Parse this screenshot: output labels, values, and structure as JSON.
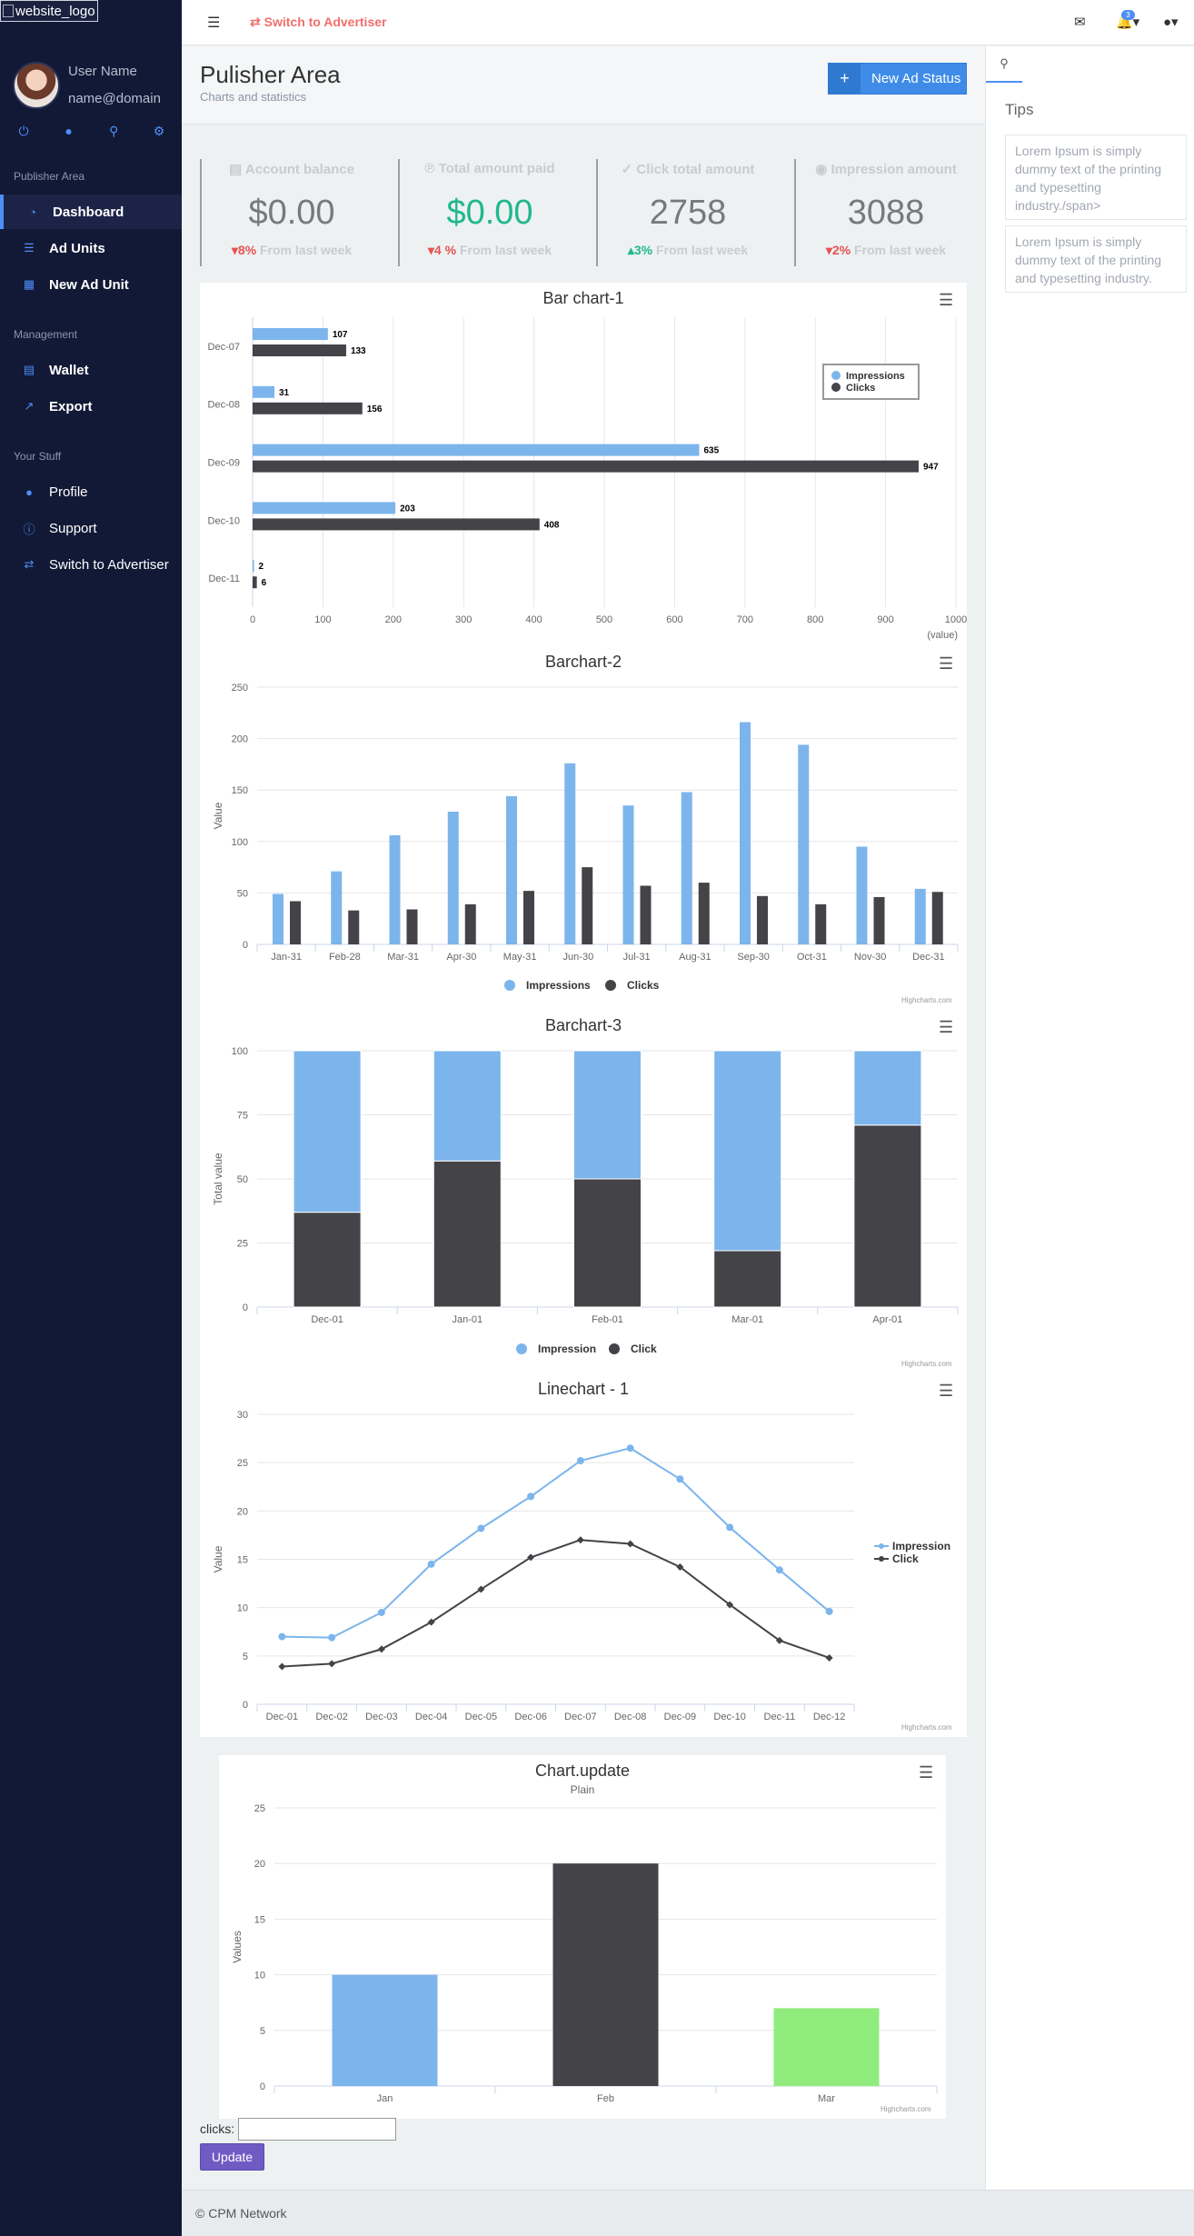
{
  "logo_alt": "website_logo",
  "user": {
    "name": "User Name",
    "email": "name@domain"
  },
  "sidebar": {
    "sections": [
      "Publisher Area",
      "Management",
      "Your Stuff"
    ],
    "items": [
      {
        "label": "Dashboard",
        "icon": "dashboard-icon"
      },
      {
        "label": "Ad Units",
        "icon": "list-icon"
      },
      {
        "label": "New Ad Unit",
        "icon": "grid-icon"
      },
      {
        "label": "Wallet",
        "icon": "credit-card-icon"
      },
      {
        "label": "Export",
        "icon": "export-icon"
      },
      {
        "label": "Profile",
        "icon": "user-icon"
      },
      {
        "label": "Support",
        "icon": "help-icon"
      },
      {
        "label": "Switch to Advertiser",
        "icon": "shuffle-icon"
      }
    ]
  },
  "topbar": {
    "switch_label": "Switch to Advertiser",
    "notification_count": "3"
  },
  "header": {
    "title": "Pulisher Area",
    "subtitle": "Charts and statistics",
    "new_button": "New Ad Status"
  },
  "stats": [
    {
      "title": "Account balance",
      "value": "$0.00",
      "change": "8%",
      "suffix": "From last week"
    },
    {
      "title": "Total amount paid",
      "value": "$0.00",
      "change": "4 %",
      "suffix": "From last week"
    },
    {
      "title": "Click total amount",
      "value": "2758",
      "change": "3%",
      "suffix": "From last week"
    },
    {
      "title": "Impression amount",
      "value": "3088",
      "change": "2%",
      "suffix": "From last week"
    }
  ],
  "tips": {
    "heading": "Tips",
    "items": [
      "Lorem Ipsum is simply dummy text of the printing and typesetting industry./span>",
      "Lorem Ipsum is simply dummy text of the printing and typesetting industry."
    ]
  },
  "credit": "Highcharts.com",
  "chart_data": [
    {
      "type": "bar",
      "orientation": "horizontal",
      "title": "Bar chart-1",
      "categories": [
        "Dec-07",
        "Dec-08",
        "Dec-09",
        "Dec-10",
        "Dec-11"
      ],
      "series": [
        {
          "name": "Impressions",
          "values": [
            107,
            31,
            635,
            203,
            2
          ],
          "color": "#7cb5ec"
        },
        {
          "name": "Clicks",
          "values": [
            133,
            156,
            947,
            408,
            6
          ],
          "color": "#434348"
        }
      ],
      "xticks": [
        0,
        100,
        200,
        300,
        400,
        500,
        600,
        700,
        800,
        900,
        1000
      ],
      "xlim": [
        0,
        1000
      ],
      "xlabel": "(value)",
      "legend": "top-right"
    },
    {
      "type": "bar",
      "title": "Barchart-2",
      "categories": [
        "Jan-31",
        "Feb-28",
        "Mar-31",
        "Apr-30",
        "May-31",
        "Jun-30",
        "Jul-31",
        "Aug-31",
        "Sep-30",
        "Oct-31",
        "Nov-30",
        "Dec-31"
      ],
      "series": [
        {
          "name": "Impressions",
          "values": [
            49,
            71,
            106,
            129,
            144,
            176,
            135,
            148,
            216,
            194,
            95,
            54
          ],
          "color": "#7cb5ec"
        },
        {
          "name": "Clicks",
          "values": [
            42,
            33,
            34,
            39,
            52,
            75,
            57,
            60,
            47,
            39,
            46,
            51
          ],
          "color": "#434348"
        }
      ],
      "ylim": [
        0,
        250
      ],
      "yticks": [
        0,
        50,
        100,
        150,
        200,
        250
      ],
      "ylabel": "Value",
      "legend": "bottom"
    },
    {
      "type": "bar",
      "stacked": "percent",
      "title": "Barchart-3",
      "categories": [
        "Dec-01",
        "Jan-01",
        "Feb-01",
        "Mar-01",
        "Apr-01"
      ],
      "series": [
        {
          "name": "Impression",
          "values": [
            63,
            43,
            50,
            78,
            29
          ],
          "color": "#7cb5ec"
        },
        {
          "name": "Click",
          "values": [
            37,
            57,
            50,
            22,
            71
          ],
          "color": "#434348"
        }
      ],
      "ylim": [
        0,
        100
      ],
      "yticks": [
        0,
        25,
        50,
        75,
        100
      ],
      "ylabel": "Total value",
      "legend": "bottom"
    },
    {
      "type": "line",
      "title": "Linechart - 1",
      "categories": [
        "Dec-01",
        "Dec-02",
        "Dec-03",
        "Dec-04",
        "Dec-05",
        "Dec-06",
        "Dec-07",
        "Dec-08",
        "Dec-09",
        "Dec-10",
        "Dec-11",
        "Dec-12"
      ],
      "series": [
        {
          "name": "Impression",
          "values": [
            7.0,
            6.9,
            9.5,
            14.5,
            18.2,
            21.5,
            25.2,
            26.5,
            23.3,
            18.3,
            13.9,
            9.6
          ],
          "color": "#7cb5ec"
        },
        {
          "name": "Click",
          "values": [
            3.9,
            4.2,
            5.7,
            8.5,
            11.9,
            15.2,
            17.0,
            16.6,
            14.2,
            10.3,
            6.6,
            4.8
          ],
          "color": "#434348"
        }
      ],
      "ylim": [
        0,
        30
      ],
      "yticks": [
        0,
        5,
        10,
        15,
        20,
        25,
        30
      ],
      "ylabel": "Value",
      "legend": "right"
    },
    {
      "type": "bar",
      "title": "Chart.update",
      "subtitle": "Plain",
      "categories": [
        "Jan",
        "Feb",
        "Mar"
      ],
      "values": [
        10,
        20,
        7
      ],
      "colors": [
        "#7cb5ec",
        "#434348",
        "#90ed7d"
      ],
      "ylim": [
        0,
        25
      ],
      "yticks": [
        0,
        5,
        10,
        15,
        20,
        25
      ],
      "ylabel": "Values"
    }
  ],
  "form": {
    "clicks_label": "clicks:",
    "clicks_value": "",
    "update_label": "Update"
  },
  "footer": {
    "text": "© CPM Network"
  }
}
